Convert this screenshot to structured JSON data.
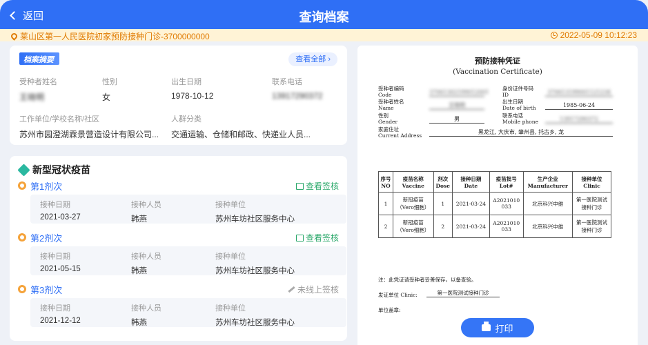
{
  "header": {
    "back_label": "返回",
    "title": "查询档案"
  },
  "infobar": {
    "location": "莱山区第一人民医院初家预防接种门诊-3700000000",
    "datetime": "2022-05-09 10:12:23"
  },
  "summary": {
    "badge": "档案摘要",
    "view_all": "查看全部",
    "fields": [
      {
        "label": "受种者姓名",
        "value": "王晓明"
      },
      {
        "label": "性别",
        "value": "女"
      },
      {
        "label": "出生日期",
        "value": "1978-10-12"
      },
      {
        "label": "联系电话",
        "value": "13917290372"
      },
      {
        "label": "工作单位/学校名称/社区",
        "value": "苏州市园澄湖霖景营造设计有限公司..."
      },
      {
        "label": "人群分类",
        "value": "交通运输、仓储和邮政、快递业人员..."
      }
    ]
  },
  "vaccine": {
    "title": "新型冠状疫苗",
    "col_labels": [
      "接种日期",
      "接种人员",
      "接种单位"
    ],
    "doses": [
      {
        "label": "第1剂次",
        "sign": "查看签核",
        "date": "2021-03-27",
        "staff": "韩燕",
        "unit": "苏州车坊社区服务中心"
      },
      {
        "label": "第2剂次",
        "sign": "查看签核",
        "date": "2021-05-15",
        "staff": "韩燕",
        "unit": "苏州车坊社区服务中心"
      },
      {
        "label": "第3剂次",
        "sign": "未线上签核",
        "date": "2021-12-12",
        "staff": "韩燕",
        "unit": "苏州车坊社区服务中心"
      }
    ]
  },
  "certificate": {
    "title_cn": "预防接种凭证",
    "title_en": "(Vaccination Certificate)",
    "code_label": "受种者编码",
    "code_label_en": "Code",
    "code_value": "37061302199012001",
    "id_label": "身份证件号码",
    "id_label_en": "ID",
    "id_value": "370613199001121234",
    "name_label": "受种者姓名",
    "name_label_en": "Name",
    "name_value": "王晓明",
    "dob_label": "出生日期",
    "dob_label_en": "Date of birth",
    "dob_value": "1985-06-24",
    "gender_label": "性别",
    "gender_label_en": "Gender",
    "gender_value": "男",
    "phone_label": "联系电话",
    "phone_label_en": "Mobile phone",
    "phone_value": "13917290372",
    "address_label": "家庭住址",
    "address_label_en": "Current Address",
    "address_value": "黑龙江, 大庆市, 肇州县, 托古乡, 龙",
    "table_headers": [
      [
        "序号",
        "NO"
      ],
      [
        "疫苗名称",
        "Vaccine"
      ],
      [
        "剂次",
        "Dose"
      ],
      [
        "接种日期",
        "Date"
      ],
      [
        "疫苗批号",
        "Lot#"
      ],
      [
        "生产企业",
        "Manufacturer"
      ],
      [
        "接种单位",
        "Clinic"
      ]
    ],
    "rows": [
      {
        "no": "1",
        "vaccine1": "新冠疫苗",
        "vaccine2": "（Vero细胞）",
        "dose": "1",
        "date": "2021-03-24",
        "lot1": "A2021010",
        "lot2": "033",
        "maker": "北京科兴中维",
        "clinic1": "第一医院测试",
        "clinic2": "接种门诊"
      },
      {
        "no": "2",
        "vaccine1": "新冠疫苗",
        "vaccine2": "（Vero细胞）",
        "dose": "2",
        "date": "2021-03-24",
        "lot1": "A2021010",
        "lot2": "033",
        "maker": "北京科兴中维",
        "clinic1": "第一医院测试",
        "clinic2": "接种门诊"
      }
    ],
    "note": "注：此凭证请受种者妥善保存，以备查验。",
    "issuer_label": "发证单位 Clinic:",
    "issuer_value": "第一医院测试接种门诊",
    "seal_label": "单位盖章:",
    "print_label": "打印"
  }
}
